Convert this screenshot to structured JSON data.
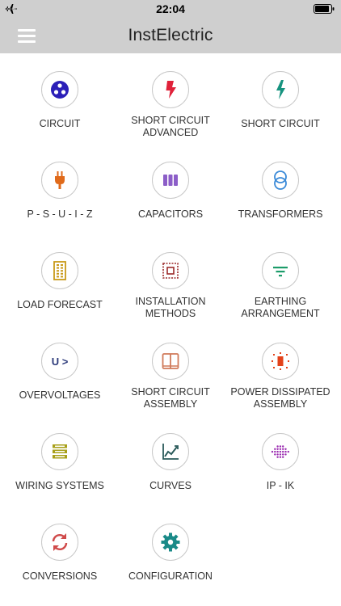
{
  "status": {
    "time": "22:04"
  },
  "header": {
    "title": "InstElectric"
  },
  "tiles": [
    {
      "label": "CIRCUIT",
      "icon": "circuit-icon",
      "color": "#2b1fb8"
    },
    {
      "label": "SHORT CIRCUIT\nADVANCED",
      "icon": "lightning-red-icon",
      "color": "#e0223a"
    },
    {
      "label": "SHORT CIRCUIT",
      "icon": "lightning-teal-icon",
      "color": "#16937f"
    },
    {
      "label": "P - S - U - I - Z",
      "icon": "plug-icon",
      "color": "#e06a1a"
    },
    {
      "label": "CAPACITORS",
      "icon": "capacitor-icon",
      "color": "#8c5ec8"
    },
    {
      "label": "TRANSFORMERS",
      "icon": "transformer-icon",
      "color": "#3a8ad8"
    },
    {
      "label": "LOAD FORECAST",
      "icon": "building-icon",
      "color": "#c99a1a"
    },
    {
      "label": "INSTALLATION\nMETHODS",
      "icon": "chip-icon",
      "color": "#9b2a2a"
    },
    {
      "label": "EARTHING\nARRANGEMENT",
      "icon": "earthing-icon",
      "color": "#1c9c6a"
    },
    {
      "label": "OVERVOLTAGES",
      "icon": "overvoltage-icon",
      "color": "#2c3a7a",
      "text": "U >"
    },
    {
      "label": "SHORT CIRCUIT\nASSEMBLY",
      "icon": "panel-icon",
      "color": "#d07a5a"
    },
    {
      "label": "POWER DISSIPATED\nASSEMBLY",
      "icon": "power-icon",
      "color": "#e3421a"
    },
    {
      "label": "WIRING SYSTEMS",
      "icon": "wiring-icon",
      "color": "#a8a01a"
    },
    {
      "label": "CURVES",
      "icon": "chart-icon",
      "color": "#2a5a5a"
    },
    {
      "label": "IP - IK",
      "icon": "dots-icon",
      "color": "#9a2ab0"
    },
    {
      "label": "CONVERSIONS",
      "icon": "refresh-icon",
      "color": "#d04a4a"
    },
    {
      "label": "CONFIGURATION",
      "icon": "gear-icon",
      "color": "#1a8a88"
    }
  ]
}
